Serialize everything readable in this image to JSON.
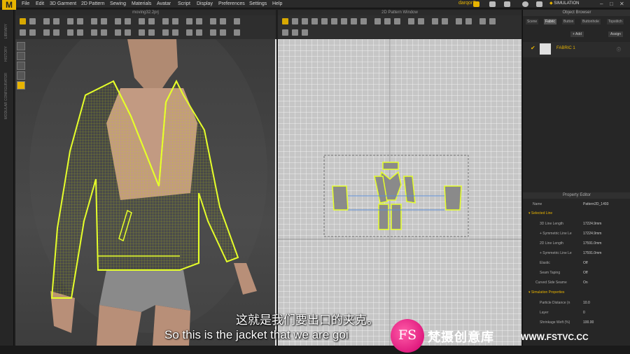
{
  "app": {
    "logo_letter": "M"
  },
  "menu": [
    "File",
    "Edit",
    "3D Garment",
    "2D Pattern",
    "Sewing",
    "Materials",
    "Avatar",
    "Script",
    "Display",
    "Preferences",
    "Settings",
    "Help"
  ],
  "account": {
    "user": "darqorS"
  },
  "simulation": {
    "label": "SIMULATION"
  },
  "sidebar_labels": [
    "LIBRARY",
    "HISTORY",
    "MODULAR CONFIGURATOR"
  ],
  "viewport3d": {
    "title": "moving32.2prj"
  },
  "viewport2d": {
    "title": "2D Pattern Window"
  },
  "object_browser": {
    "title": "Object Browser",
    "tabs": [
      "Scene",
      "Fabric",
      "Button",
      "Buttonhole",
      "Topstitch"
    ],
    "active_tab": "Fabric",
    "add_label": "+ Add",
    "assign_label": "Assign",
    "fabric_name": "FABRIC 1"
  },
  "property_editor": {
    "title": "Property Editor",
    "name_label": "Name",
    "name_value": "Pattern2D_1493",
    "section_selected": "Selected Line",
    "rows": [
      {
        "label": "3D Line Length",
        "value": "17224.9mm"
      },
      {
        "label": "+ Symmetric Line Le",
        "value": "17224.9mm"
      },
      {
        "label": "2D Line Length",
        "value": "17591.0mm"
      },
      {
        "label": "+ Symmetric Line Le",
        "value": "17591.0mm"
      },
      {
        "label": "Elastic",
        "value": "Off"
      },
      {
        "label": "Seam Taping",
        "value": "Off"
      },
      {
        "label": "Curved Side Seame",
        "value": "On"
      }
    ],
    "section_simulation": "Simulation Properties",
    "sim_rows": [
      {
        "label": "Particle Distance (n",
        "value": "10.0"
      },
      {
        "label": "Layer",
        "value": "0"
      },
      {
        "label": "Shrinkage Weft (%)",
        "value": "100.00"
      }
    ]
  },
  "subtitles": {
    "chinese": "这就是我们要出口的夹克。",
    "english": "So this is the jacket that we are goi"
  },
  "watermark": {
    "logo_text": "FS",
    "chinese": "梵摄创意库",
    "url": "WWW.FSTVC.CC"
  },
  "colors": {
    "accent": "#e8b400",
    "garment": "#e6ff2a",
    "watermark": "#e0147a"
  }
}
